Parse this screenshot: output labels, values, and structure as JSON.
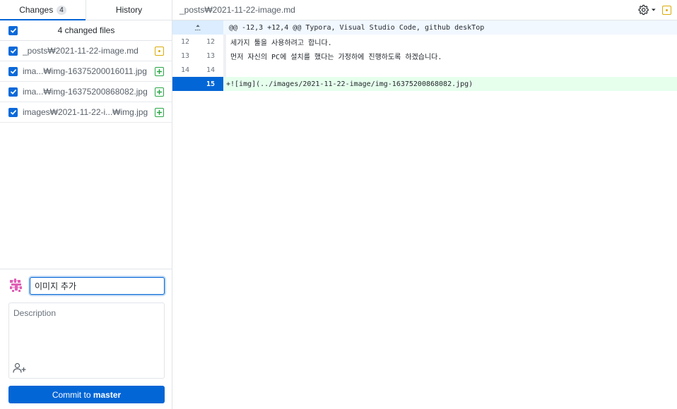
{
  "tabs": {
    "changes_label": "Changes",
    "changes_count": "4",
    "history_label": "History"
  },
  "changes": {
    "header": "4 changed files",
    "files": [
      {
        "name": "_posts₩2021-11-22-image.md",
        "status": "modified"
      },
      {
        "name": "ima...₩img-16375200016011.jpg",
        "status": "added"
      },
      {
        "name": "ima...₩img-16375200868082.jpg",
        "status": "added"
      },
      {
        "name": "images₩2021-11-22-i...₩img.jpg",
        "status": "added"
      }
    ]
  },
  "commit": {
    "summary_value": "이미지 추가",
    "description_placeholder": "Description",
    "button_prefix": "Commit to ",
    "branch": "master"
  },
  "diff": {
    "file_path": "_posts₩2021-11-22-image.md",
    "hunk_header": "@@ -12,3 +12,4 @@ Typora, Visual Studio Code, github deskTop",
    "lines": [
      {
        "old": "12",
        "new": "12",
        "text": "세가지 툴을 사용하려고 합니다.",
        "type": "context"
      },
      {
        "old": "13",
        "new": "13",
        "text": "먼저 자신의 PC에 설치를 했다는 가정하에 진행하도록 하겠습니다.",
        "type": "context"
      },
      {
        "old": "14",
        "new": "14",
        "text": "",
        "type": "context"
      },
      {
        "old": "",
        "new": "15",
        "text": "+![img](../images/2021-11-22-image/img-16375200868082.jpg)",
        "type": "added"
      }
    ]
  },
  "colors": {
    "accent": "#0366d6",
    "modified": "#dbab09",
    "added": "#28a745",
    "added_bg": "#e6ffed"
  },
  "icons": {
    "settings": "gear-icon",
    "modified": "modified-file-icon",
    "added": "added-file-icon",
    "expand": "expand-up-icon",
    "coauthor": "add-coauthor-icon"
  }
}
